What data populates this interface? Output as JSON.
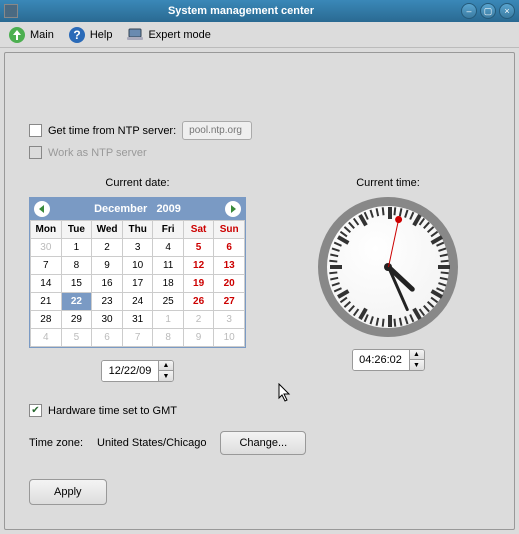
{
  "window": {
    "title": "System management center"
  },
  "toolbar": {
    "main": "Main",
    "help": "Help",
    "expert": "Expert mode"
  },
  "ntp": {
    "get_label": "Get time from NTP server:",
    "placeholder": "pool.ntp.org",
    "work_label": "Work as NTP server"
  },
  "date": {
    "header": "Current date:",
    "month": "December",
    "year": "2009",
    "dow": [
      "Mon",
      "Tue",
      "Wed",
      "Thu",
      "Fri",
      "Sat",
      "Sun"
    ],
    "value": "12/22/09"
  },
  "time": {
    "header": "Current time:",
    "value": "04:26:02"
  },
  "hw_gmt": "Hardware time set to GMT",
  "tz": {
    "label": "Time zone:",
    "value": "United States/Chicago",
    "change": "Change..."
  },
  "apply": "Apply",
  "chart_data": {
    "type": "table",
    "title": "December 2009",
    "columns": [
      "Mon",
      "Tue",
      "Wed",
      "Thu",
      "Fri",
      "Sat",
      "Sun"
    ],
    "rows": [
      [
        {
          "v": 30,
          "other": true
        },
        {
          "v": 1
        },
        {
          "v": 2
        },
        {
          "v": 3
        },
        {
          "v": 4
        },
        {
          "v": 5,
          "we": true
        },
        {
          "v": 6,
          "we": true
        }
      ],
      [
        {
          "v": 7
        },
        {
          "v": 8
        },
        {
          "v": 9
        },
        {
          "v": 10
        },
        {
          "v": 11
        },
        {
          "v": 12,
          "we": true
        },
        {
          "v": 13,
          "we": true
        }
      ],
      [
        {
          "v": 14
        },
        {
          "v": 15
        },
        {
          "v": 16
        },
        {
          "v": 17
        },
        {
          "v": 18
        },
        {
          "v": 19,
          "we": true
        },
        {
          "v": 20,
          "we": true
        }
      ],
      [
        {
          "v": 21
        },
        {
          "v": 22,
          "sel": true
        },
        {
          "v": 23
        },
        {
          "v": 24
        },
        {
          "v": 25
        },
        {
          "v": 26,
          "we": true
        },
        {
          "v": 27,
          "we": true
        }
      ],
      [
        {
          "v": 28
        },
        {
          "v": 29
        },
        {
          "v": 30
        },
        {
          "v": 31
        },
        {
          "v": 1,
          "other": true
        },
        {
          "v": 2,
          "other": true
        },
        {
          "v": 3,
          "other": true
        }
      ],
      [
        {
          "v": 4,
          "other": true
        },
        {
          "v": 5,
          "other": true
        },
        {
          "v": 6,
          "other": true
        },
        {
          "v": 7,
          "other": true
        },
        {
          "v": 8,
          "other": true
        },
        {
          "v": 9,
          "other": true
        },
        {
          "v": 10,
          "other": true
        }
      ]
    ],
    "selected": "2009-12-22",
    "time": {
      "h": 4,
      "m": 26,
      "s": 2
    }
  }
}
